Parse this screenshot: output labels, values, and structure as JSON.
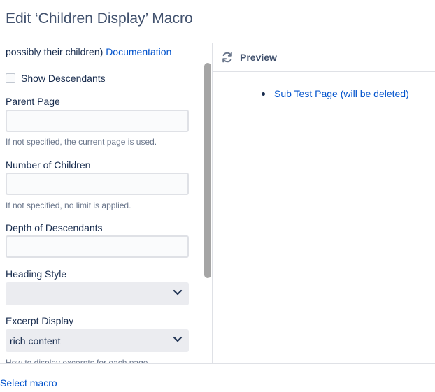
{
  "dialog": {
    "title": "Edit ‘Children Display’ Macro"
  },
  "form": {
    "intro_text": "possibly their children)",
    "documentation_link": "Documentation",
    "show_descendants_label": "Show Descendants",
    "show_descendants_checked": false,
    "parent_page": {
      "label": "Parent Page",
      "value": "",
      "help": "If not specified, the current page is used."
    },
    "number_of_children": {
      "label": "Number of Children",
      "value": "",
      "help": "If not specified, no limit is applied."
    },
    "depth_of_descendants": {
      "label": "Depth of Descendants",
      "value": ""
    },
    "heading_style": {
      "label": "Heading Style",
      "selected": ""
    },
    "excerpt_display": {
      "label": "Excerpt Display",
      "selected": "rich content",
      "help": "How to display excerpts for each page."
    }
  },
  "preview": {
    "title": "Preview",
    "items": [
      "Sub Test Page (will be deleted)"
    ]
  },
  "footer": {
    "select_macro_link": "Select macro"
  },
  "icons": {
    "refresh": "refresh-icon",
    "chevron": "chevron-down-icon"
  },
  "colors": {
    "link": "#0052cc",
    "text": "#172b4d",
    "muted": "#6b778c",
    "input_border": "#dfe1e6",
    "select_bg": "#ebecf0"
  }
}
